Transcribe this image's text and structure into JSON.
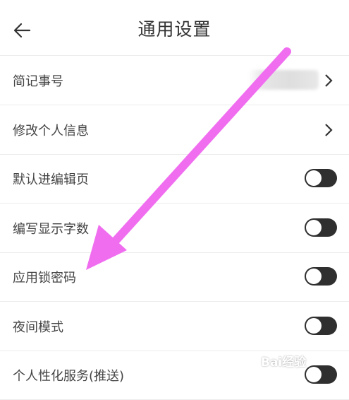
{
  "header": {
    "title": "通用设置",
    "back_icon": "arrow-left-icon"
  },
  "rows": [
    {
      "label": "简记事号",
      "control": "chevron",
      "value_blurred": true
    },
    {
      "label": "修改个人信息",
      "control": "chevron"
    },
    {
      "label": "默认进编辑页",
      "control": "toggle",
      "on": false
    },
    {
      "label": "编写显示字数",
      "control": "toggle",
      "on": false
    },
    {
      "label": "应用锁密码",
      "control": "toggle",
      "on": false
    },
    {
      "label": "夜间模式",
      "control": "toggle",
      "on": false
    },
    {
      "label": "个人性化服务(推送)",
      "control": "toggle",
      "on": false
    }
  ],
  "annotation": {
    "arrow_color": "#f06df0",
    "points_to": "应用锁密码"
  },
  "watermark": {
    "text": "Bai经验"
  },
  "colors": {
    "toggle_track": "#2f2f2f",
    "divider": "#ececec",
    "text": "#444444"
  }
}
